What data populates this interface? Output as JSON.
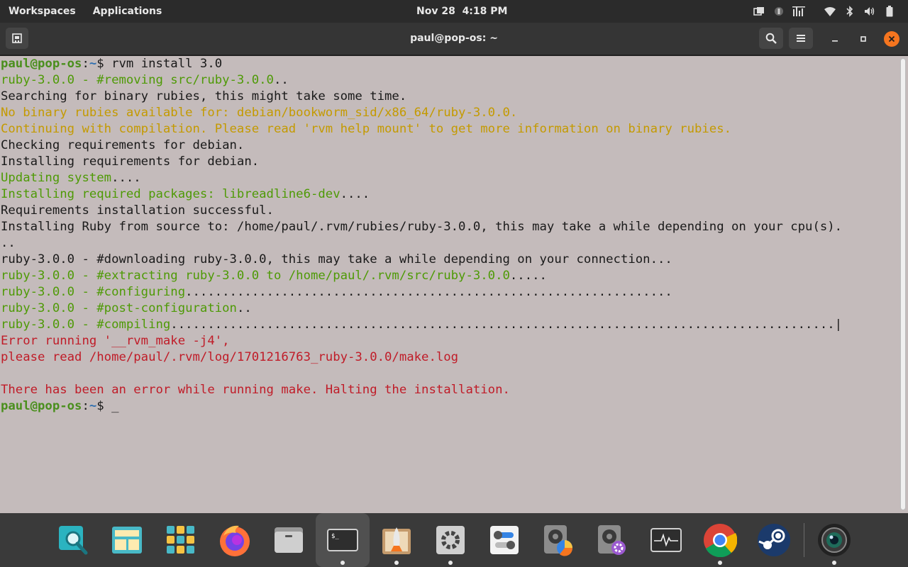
{
  "topbar": {
    "workspaces": "Workspaces",
    "applications": "Applications",
    "clock": "Nov 28  4:18 PM"
  },
  "window": {
    "title": "paul@pop-os: ~"
  },
  "terminal": {
    "lines": [
      [
        {
          "t": "paul@pop-os",
          "c": "prompt"
        },
        {
          "t": ":",
          "c": "dark"
        },
        {
          "t": "~",
          "c": "path"
        },
        {
          "t": "$ rvm install 3.0",
          "c": "dark"
        }
      ],
      [
        {
          "t": "ruby-3.0.0 - #removing src/ruby-3.0.0",
          "c": "green"
        },
        {
          "t": "..",
          "c": "dark"
        }
      ],
      [
        {
          "t": "Searching for binary rubies, this might take some time.",
          "c": "dark"
        }
      ],
      [
        {
          "t": "No binary rubies available for: debian/bookworm_sid/x86_64/ruby-3.0.0.",
          "c": "yellow"
        }
      ],
      [
        {
          "t": "Continuing with compilation. Please read 'rvm help mount' to get more information on binary rubies.",
          "c": "yellow"
        }
      ],
      [
        {
          "t": "Checking requirements for debian.",
          "c": "dark"
        }
      ],
      [
        {
          "t": "Installing requirements for debian.",
          "c": "dark"
        }
      ],
      [
        {
          "t": "Updating system",
          "c": "green"
        },
        {
          "t": "....",
          "c": "dark"
        }
      ],
      [
        {
          "t": "Installing required packages: libreadline6-dev",
          "c": "green"
        },
        {
          "t": "....",
          "c": "dark"
        }
      ],
      [
        {
          "t": "Requirements installation successful.",
          "c": "dark"
        }
      ],
      [
        {
          "t": "Installing Ruby from source to: /home/paul/.rvm/rubies/ruby-3.0.0, this may take a while depending on your cpu(s).",
          "c": "dark"
        }
      ],
      [
        {
          "t": "..",
          "c": "dark"
        }
      ],
      [
        {
          "t": "ruby-3.0.0 - #downloading ruby-3.0.0, this may take a while depending on your connection...",
          "c": "dark"
        }
      ],
      [
        {
          "t": "ruby-3.0.0 - #extracting ruby-3.0.0 to /home/paul/.rvm/src/ruby-3.0.0",
          "c": "green"
        },
        {
          "t": ".....",
          "c": "dark"
        }
      ],
      [
        {
          "t": "ruby-3.0.0 - #configuring",
          "c": "green"
        },
        {
          "t": "..................................................................",
          "c": "dark"
        }
      ],
      [
        {
          "t": "ruby-3.0.0 - #post-configuration",
          "c": "green"
        },
        {
          "t": "..",
          "c": "dark"
        }
      ],
      [
        {
          "t": "ruby-3.0.0 - #compiling",
          "c": "green"
        },
        {
          "t": "..........................................................................................|",
          "c": "dark"
        }
      ],
      [
        {
          "t": "Error running '__rvm_make -j4',",
          "c": "red"
        }
      ],
      [
        {
          "t": "please read /home/paul/.rvm/log/1701216763_ruby-3.0.0/make.log",
          "c": "red"
        }
      ],
      [
        {
          "t": "",
          "c": "dark"
        }
      ],
      [
        {
          "t": "There has been an error while running make. Halting the installation.",
          "c": "red"
        }
      ],
      [
        {
          "t": "paul@pop-os",
          "c": "prompt"
        },
        {
          "t": ":",
          "c": "dark"
        },
        {
          "t": "~",
          "c": "path"
        },
        {
          "t": "$ _",
          "c": "dark"
        }
      ]
    ]
  },
  "dock": {
    "apps": [
      {
        "icon": "search-launcher-icon",
        "running": false
      },
      {
        "icon": "workspaces-icon",
        "running": false
      },
      {
        "icon": "app-grid-icon",
        "running": false
      },
      {
        "icon": "firefox-icon",
        "running": false
      },
      {
        "icon": "files-icon",
        "running": false
      },
      {
        "icon": "terminal-icon",
        "running": true,
        "active": true
      },
      {
        "icon": "pop-shop-icon",
        "running": true
      },
      {
        "icon": "settings-icon",
        "running": true
      },
      {
        "icon": "tweaks-icon",
        "running": false
      },
      {
        "icon": "disk-usage-icon",
        "running": false
      },
      {
        "icon": "disks-icon",
        "running": false
      },
      {
        "icon": "system-monitor-icon",
        "running": false
      },
      {
        "icon": "chrome-icon",
        "running": true
      },
      {
        "icon": "steam-icon",
        "running": false
      },
      {
        "icon": "camera-icon",
        "running": true
      }
    ]
  },
  "colors": {
    "terminal_bg": "#c4bbbb",
    "prompt_green": "#4a8f1d",
    "path_blue": "#2f6fb0",
    "output_green": "#4e9a06",
    "warning_yellow": "#c49a00",
    "error_red": "#c01c28",
    "close_button": "#f5751f"
  }
}
